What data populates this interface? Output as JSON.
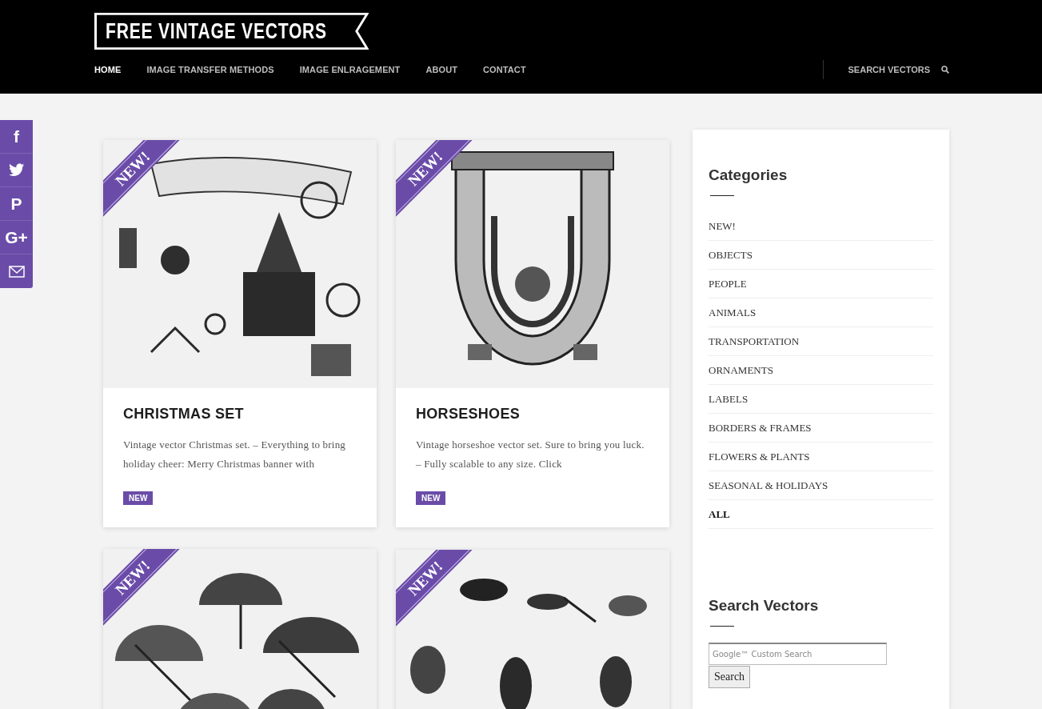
{
  "header": {
    "logo": "FREE VINTAGE VECTORS",
    "nav": [
      {
        "label": "HOME",
        "selected": true
      },
      {
        "label": "IMAGE TRANSFER METHODS",
        "selected": false
      },
      {
        "label": "IMAGE ENLRAGEMENT",
        "selected": false
      },
      {
        "label": "ABOUT",
        "selected": false
      },
      {
        "label": "CONTACT",
        "selected": false
      }
    ],
    "search_label": "SEARCH VECTORS"
  },
  "social": [
    {
      "kind": "glyph",
      "text": "f"
    },
    {
      "kind": "bird"
    },
    {
      "kind": "glyph",
      "text": "P"
    },
    {
      "kind": "glyph",
      "text": "G+"
    },
    {
      "kind": "mail"
    }
  ],
  "columns": [
    [
      {
        "ribbon": "NEW!",
        "title": "CHRISTMAS SET",
        "excerpt": "Vintage vector Christmas set.  – Everything to bring holiday cheer: Merry Christmas banner with",
        "badge": "NEW"
      },
      {
        "ribbon": "NEW!"
      }
    ],
    [
      {
        "ribbon": "NEW!",
        "title": "HORSESHOES",
        "excerpt": "Vintage horseshoe vector set. Sure to bring you luck.  –  Fully scalable to any size. Click",
        "badge": "NEW"
      },
      {
        "ribbon": "NEW!"
      }
    ]
  ],
  "sidebar": {
    "categories_title": "Categories",
    "categories": [
      {
        "label": "NEW!",
        "emphasized": false
      },
      {
        "label": "OBJECTS",
        "emphasized": false
      },
      {
        "label": "PEOPLE",
        "emphasized": false
      },
      {
        "label": "ANIMALS",
        "emphasized": false
      },
      {
        "label": "TRANSPORTATION",
        "emphasized": false
      },
      {
        "label": "ORNAMENTS",
        "emphasized": false
      },
      {
        "label": "LABELS",
        "emphasized": false
      },
      {
        "label": "BORDERS & FRAMES",
        "emphasized": false
      },
      {
        "label": "FLOWERS & PLANTS",
        "emphasized": false
      },
      {
        "label": "SEASONAL & HOLIDAYS",
        "emphasized": false
      },
      {
        "label": "ALL",
        "emphasized": true
      }
    ],
    "search_title": "Search Vectors",
    "search": {
      "placeholder": "Google™ Custom Search",
      "button": "Search"
    }
  }
}
